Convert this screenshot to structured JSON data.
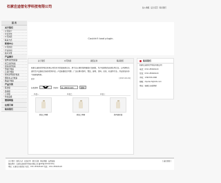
{
  "header": {
    "logo_text": "石家庄迪普化学科技有限公司",
    "links": [
      "加入收藏",
      "设为首页",
      "联系我们"
    ]
  },
  "sidebar": {
    "blocks": [
      {
        "head": "首 页"
      },
      {
        "head": "关于我们",
        "items": [
          "公司简介",
          "企业文化",
          "公司资质",
          "联系方式"
        ]
      },
      {
        "head": "新闻中心",
        "items": [
          "公司新闻",
          "行业新闻",
          "技术文章"
        ]
      },
      {
        "head": "产品展示",
        "items": [
          "羧甲基纤维素钠",
          "羟乙基纤维素",
          "羟丙基纤维素",
          "甲基纤维素",
          "乙基纤维素",
          "羟丙基甲基纤维素",
          "聚阴离子纤维素",
          "微晶纤维素"
        ]
      },
      {
        "head": "产品分类",
        "items": [
          "医药级",
          "食品级",
          "工业级",
          "化妆品级"
        ]
      },
      {
        "head": "营销网络"
      },
      {
        "head": "在线订单"
      },
      {
        "head": "联系我们"
      }
    ]
  },
  "flash": {
    "message": "Couldn't load plugin."
  },
  "tabs": [
    "关于我们",
    "公司新闻",
    "资质证书",
    "联系我们"
  ],
  "intro": {
    "text": "石家庄迪普化学科技有限公司位于河北省石家庄市，是专业从事纤维素醚类产品研发、生产和销售的高新技术企业。公司拥有先进的生产设备和完善的检测手段，产品质量稳定可靠，广泛应用于医药、食品、建材、涂料、日化、石油等行业，并远销海外多个国家和地区。",
    "more": "更多",
    "date": "[2013-04-19]"
  },
  "search": {
    "label_category": "分类搜索",
    "category_value": "所有类型",
    "label_keyword": "关键字",
    "keyword_value": "输入搜索的关键字",
    "button": "搜索"
  },
  "product_header": [
    "产品一",
    "产品二",
    "产品三"
  ],
  "products": [
    {
      "name": "纤维二甲醛"
    },
    {
      "name": "纤维二甲醇"
    },
    {
      "name": "羟丙基纤维"
    }
  ],
  "contact": {
    "title": "联系我们",
    "lines": [
      "石家庄迪普化学科技有限公司",
      "电话：0311-85626120",
      "传真：0311-85626120",
      "手机：13903311968",
      "邮箱：diputech@126.com",
      "地址：石家庄市桥西区"
    ]
  },
  "footer": {
    "nav": [
      "关于我们",
      "联系方式",
      "在线订单",
      "留言反馈",
      "网站地图",
      "友情链接"
    ],
    "right": "[ 返回顶部 ]",
    "line1": "版权所有：石家庄迪普化学科技有限公司  冀ICP备12002218号",
    "line2": "地址：石家庄市桥西区  电话：0311-85626120  传真：0311-85626120"
  }
}
